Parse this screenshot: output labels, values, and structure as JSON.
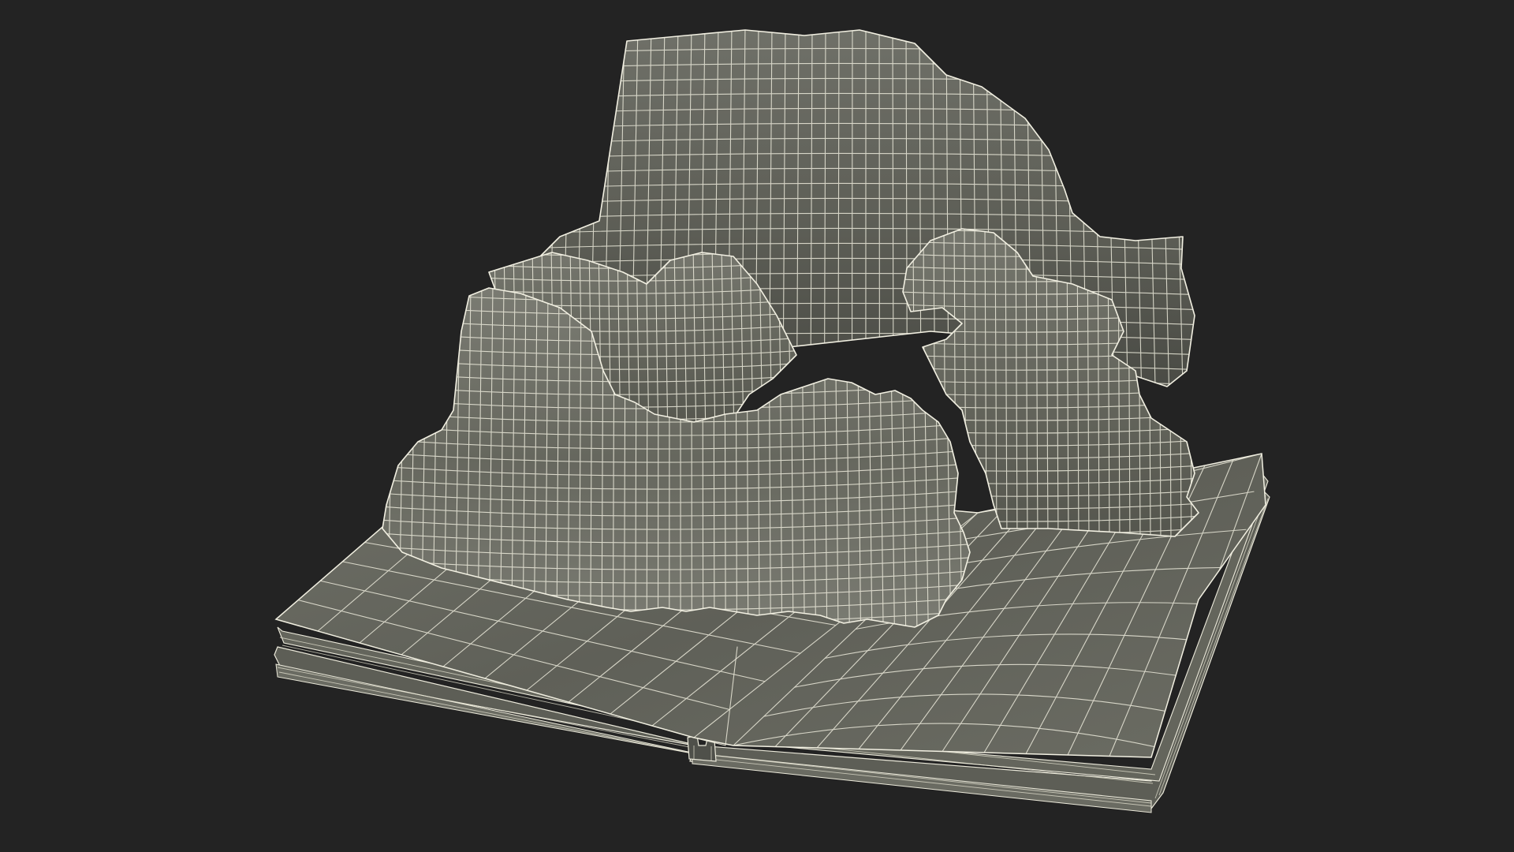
{
  "scene": {
    "subject": "pop-up-book-wireframe-model",
    "background_color": "#232323",
    "surface_color": "#6b6c63",
    "surface_dark_color": "#55564e",
    "wire_color": "#eceadb",
    "icons": [
      "wireframe-book-model"
    ]
  }
}
